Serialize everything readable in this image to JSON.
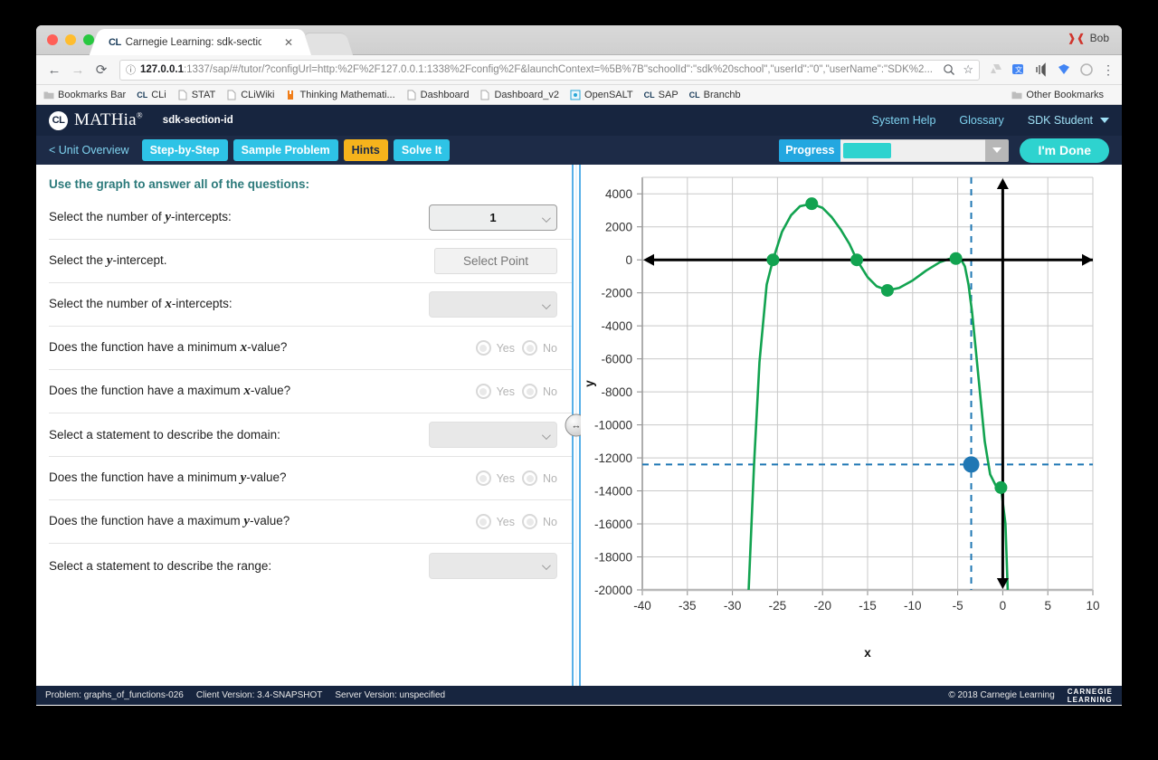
{
  "browser": {
    "tab": {
      "favicon": "CL",
      "title": "Carnegie Learning: sdk-section",
      "close": "✕"
    },
    "user": {
      "name": "Bob",
      "icon": "user-icon"
    },
    "nav": {
      "back": "←",
      "forward": "→",
      "reload": "⟳"
    },
    "omnibox": {
      "info_icon": "ⓘ",
      "url_host": "127.0.0.1",
      "url_rest": ":1337/sap/#/tutor/?configUrl=http:%2F%2F127.0.0.1:1338%2Fconfig%2F&launchContext=%5B%7B\"schoolId\":\"sdk%20school\",\"userId\":\"0\",\"userName\":\"SDK%2...",
      "zoom_icon": "search-plus-icon",
      "star_icon": "☆",
      "menu_icon": "⋮"
    },
    "bookmarks": [
      {
        "label": "Bookmarks Bar",
        "icon": "folder-icon"
      },
      {
        "label": "CLi",
        "icon": "cl-icon"
      },
      {
        "label": "STAT",
        "icon": "page-icon"
      },
      {
        "label": "CLiWiki",
        "icon": "page-icon"
      },
      {
        "label": "Thinking Mathemati...",
        "icon": "orange-icon"
      },
      {
        "label": "Dashboard",
        "icon": "page-icon"
      },
      {
        "label": "Dashboard_v2",
        "icon": "page-icon"
      },
      {
        "label": "OpenSALT",
        "icon": "salt-icon"
      },
      {
        "label": "SAP",
        "icon": "cl-icon"
      },
      {
        "label": "Branchb",
        "icon": "cl-icon"
      }
    ],
    "other_bookmarks": {
      "label": "Other Bookmarks",
      "icon": "folder-icon"
    }
  },
  "app": {
    "header": {
      "logo_mark": "CL",
      "logo_text": "MATHia",
      "logo_sup": "®",
      "section_id": "sdk-section-id",
      "links": [
        {
          "label": "System Help"
        },
        {
          "label": "Glossary"
        }
      ],
      "user": "SDK Student"
    },
    "toolbar": {
      "unit_overview": "< Unit Overview",
      "buttons": [
        {
          "label": "Step-by-Step",
          "style": "cyan"
        },
        {
          "label": "Sample Problem",
          "style": "cyan"
        },
        {
          "label": "Hints",
          "style": "amber"
        },
        {
          "label": "Solve It",
          "style": "cyan"
        }
      ],
      "progress_label": "Progress",
      "progress_percent": 34,
      "done_label": "I'm Done"
    },
    "questions": {
      "title": "Use the graph to answer all of the questions:",
      "items": [
        {
          "label_pre": "Select the number of ",
          "label_var": "y",
          "label_post": "-intercepts:",
          "control": "select",
          "value": "1",
          "state": "answered"
        },
        {
          "label_pre": "Select the ",
          "label_var": "y",
          "label_post": "-intercept.",
          "control": "point-button",
          "value": "Select Point",
          "state": "empty"
        },
        {
          "label_pre": "Select the number of ",
          "label_var": "x",
          "label_post": "-intercepts:",
          "control": "select",
          "value": "",
          "state": "empty"
        },
        {
          "label_pre": "Does the function have a minimum ",
          "label_var": "x",
          "label_post": "-value?",
          "control": "radio",
          "options": [
            "Yes",
            "No"
          ],
          "value": "",
          "state": "empty"
        },
        {
          "label_pre": "Does the function have a maximum ",
          "label_var": "x",
          "label_post": "-value?",
          "control": "radio",
          "options": [
            "Yes",
            "No"
          ],
          "value": "",
          "state": "empty"
        },
        {
          "label_pre": "Select a statement to describe the domain:",
          "label_var": "",
          "label_post": "",
          "control": "select",
          "value": "",
          "state": "empty"
        },
        {
          "label_pre": "Does the function have a minimum ",
          "label_var": "y",
          "label_post": "-value?",
          "control": "radio",
          "options": [
            "Yes",
            "No"
          ],
          "value": "",
          "state": "empty"
        },
        {
          "label_pre": "Does the function have a maximum ",
          "label_var": "y",
          "label_post": "-value?",
          "control": "radio",
          "options": [
            "Yes",
            "No"
          ],
          "value": "",
          "state": "empty"
        },
        {
          "label_pre": "Select a statement to describe the range:",
          "label_var": "",
          "label_post": "",
          "control": "select",
          "value": "",
          "state": "empty"
        }
      ]
    },
    "divider": {
      "handle_icon": "horizontal-resize-icon"
    },
    "footer": {
      "problem": "Problem: graphs_of_functions-026",
      "client_version": "Client Version: 3.4-SNAPSHOT",
      "server_version": "Server Version: unspecified",
      "copyright": "© 2018 Carnegie Learning",
      "brand_line1": "CARNEGIE",
      "brand_line2": "LEARNING"
    }
  },
  "chart_data": {
    "type": "line",
    "title": "",
    "xlabel": "x",
    "ylabel": "y",
    "xlim": [
      -40,
      10
    ],
    "ylim": [
      -20000,
      5000
    ],
    "xticks": [
      -40,
      -35,
      -30,
      -25,
      -20,
      -15,
      -10,
      -5,
      0,
      5,
      10
    ],
    "yticks": [
      4000,
      2000,
      0,
      -2000,
      -4000,
      -6000,
      -8000,
      -10000,
      -12000,
      -14000,
      -16000,
      -18000,
      -20000
    ],
    "grid": true,
    "legend": "none",
    "curve_color": "#12a350",
    "axis_color": "#000000",
    "marker_color": "#12a350",
    "selected_point_color": "#1f77b4",
    "guide_color": "#1f77b4",
    "curve": [
      {
        "x": -28.2,
        "y": -20000
      },
      {
        "x": -27.6,
        "y": -12400
      },
      {
        "x": -27.0,
        "y": -6200
      },
      {
        "x": -26.2,
        "y": -1500
      },
      {
        "x": -25.5,
        "y": 0
      },
      {
        "x": -24.5,
        "y": 1700
      },
      {
        "x": -23.5,
        "y": 2700
      },
      {
        "x": -22.5,
        "y": 3250
      },
      {
        "x": -21.2,
        "y": 3400
      },
      {
        "x": -20.0,
        "y": 3150
      },
      {
        "x": -19.0,
        "y": 2600
      },
      {
        "x": -18.0,
        "y": 1850
      },
      {
        "x": -17.0,
        "y": 950
      },
      {
        "x": -16.2,
        "y": 0
      },
      {
        "x": -15.0,
        "y": -1050
      },
      {
        "x": -14.0,
        "y": -1600
      },
      {
        "x": -12.8,
        "y": -1850
      },
      {
        "x": -11.5,
        "y": -1700
      },
      {
        "x": -10.0,
        "y": -1250
      },
      {
        "x": -8.5,
        "y": -650
      },
      {
        "x": -7.0,
        "y": -150
      },
      {
        "x": -6.0,
        "y": 50
      },
      {
        "x": -5.2,
        "y": 80
      },
      {
        "x": -4.6,
        "y": 0
      },
      {
        "x": -4.2,
        "y": -400
      },
      {
        "x": -3.8,
        "y": -1500
      },
      {
        "x": -3.4,
        "y": -3200
      },
      {
        "x": -3.0,
        "y": -5400
      },
      {
        "x": -2.5,
        "y": -8200
      },
      {
        "x": -2.0,
        "y": -11000
      },
      {
        "x": -1.4,
        "y": -13000
      },
      {
        "x": -0.8,
        "y": -13650
      },
      {
        "x": -0.2,
        "y": -13800
      },
      {
        "x": 0.3,
        "y": -16000
      },
      {
        "x": 0.55,
        "y": -20000
      }
    ],
    "markers": [
      {
        "x": -25.5,
        "y": 0,
        "kind": "x-intercept",
        "color": "#12a350"
      },
      {
        "x": -21.2,
        "y": 3400,
        "kind": "local-max",
        "color": "#12a350"
      },
      {
        "x": -16.2,
        "y": 0,
        "kind": "x-intercept",
        "color": "#12a350"
      },
      {
        "x": -12.8,
        "y": -1850,
        "kind": "local-min",
        "color": "#12a350"
      },
      {
        "x": -5.2,
        "y": 80,
        "kind": "local-max",
        "color": "#12a350"
      },
      {
        "x": -0.2,
        "y": -13800,
        "kind": "y-intercept",
        "color": "#12a350"
      }
    ],
    "selected_point": {
      "x": -3.5,
      "y": -12400,
      "color": "#1f77b4"
    },
    "guides": [
      {
        "orientation": "vertical",
        "x": -3.5,
        "style": "dashed",
        "color": "#1f77b4"
      },
      {
        "orientation": "horizontal",
        "y": -12400,
        "style": "dashed",
        "color": "#1f77b4"
      }
    ],
    "axis_arrows": {
      "x_axis_at_y": 0,
      "y_axis_at_x": 0
    }
  }
}
